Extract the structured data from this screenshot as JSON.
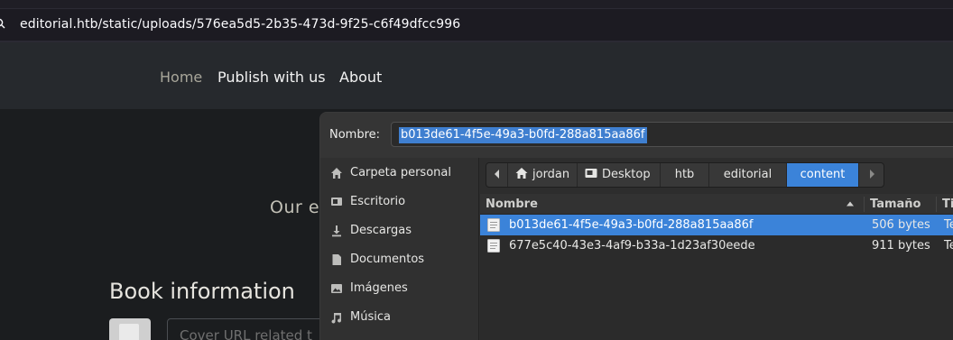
{
  "browser": {
    "url": "editorial.htb/static/uploads/576ea5d5-2b35-473d-9f25-c6f49dfcc996"
  },
  "site": {
    "nav": {
      "home": "Home",
      "publish": "Publish with us",
      "about": "About"
    },
    "hero_partial": "Our e",
    "section_title": "Book information",
    "cover_placeholder": "Cover URL related t"
  },
  "dialog": {
    "name_label": "Nombre:",
    "name_value": "b013de61-4f5e-49a3-b0fd-288a815aa86f",
    "sidebar": [
      {
        "label": "Carpeta personal",
        "icon": "home-icon"
      },
      {
        "label": "Escritorio",
        "icon": "desktop-icon"
      },
      {
        "label": "Descargas",
        "icon": "download-icon"
      },
      {
        "label": "Documentos",
        "icon": "document-icon"
      },
      {
        "label": "Imágenes",
        "icon": "image-icon"
      },
      {
        "label": "Música",
        "icon": "music-icon"
      }
    ],
    "breadcrumbs": [
      {
        "label": "jordan",
        "icon": "home-icon"
      },
      {
        "label": "Desktop",
        "icon": "desktop-icon"
      },
      {
        "label": "htb"
      },
      {
        "label": "editorial"
      },
      {
        "label": "content",
        "active": true
      }
    ],
    "columns": {
      "name": "Nombre",
      "size": "Tamaño",
      "type": "Ti"
    },
    "files": [
      {
        "name": "b013de61-4f5e-49a3-b0fd-288a815aa86f",
        "size": "506 bytes",
        "type": "Te",
        "selected": true
      },
      {
        "name": "677e5c40-43e3-4af9-b33a-1d23af30eede",
        "size": "911 bytes",
        "type": "Te",
        "selected": false
      }
    ]
  },
  "colors": {
    "accent": "#3b83d9",
    "nav_active": "#a8a69a"
  }
}
